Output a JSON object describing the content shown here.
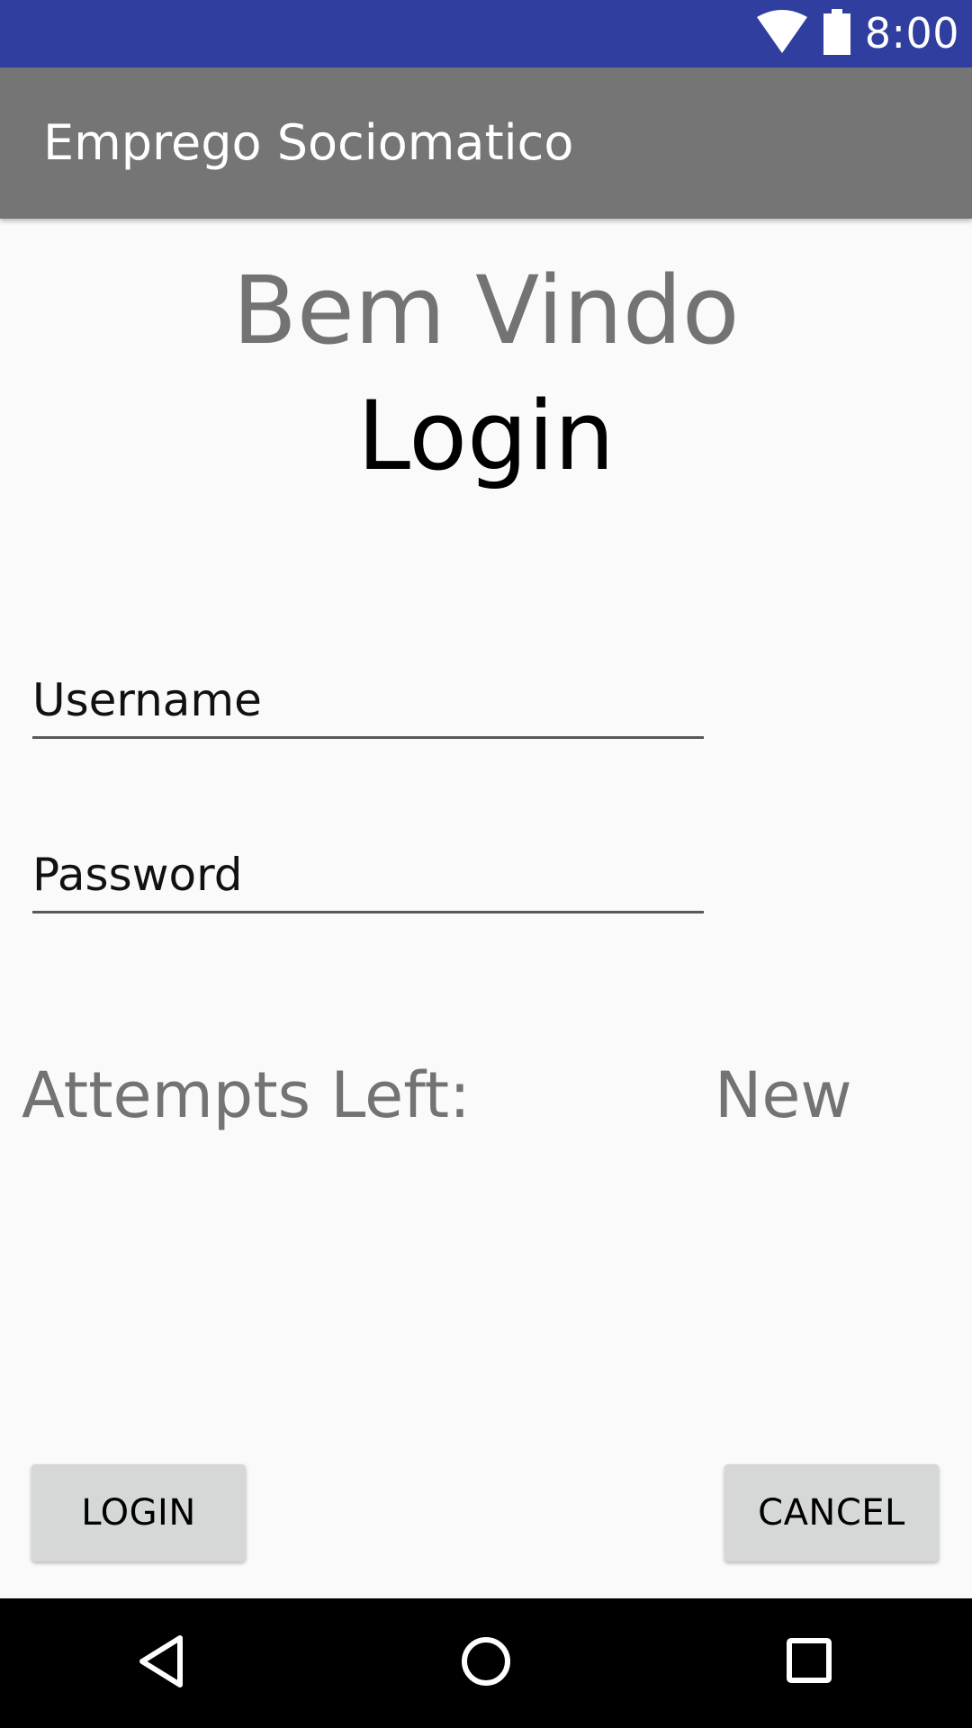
{
  "status_bar": {
    "time": "8:00",
    "icons": [
      "wifi-icon",
      "battery-icon"
    ],
    "color": "#303f9f"
  },
  "app_bar": {
    "title": "Emprego Sociomatico",
    "color": "#757575"
  },
  "main": {
    "welcome": "Bem Vindo",
    "heading": "Login",
    "username_placeholder": "Username",
    "password_placeholder": "Password",
    "attempts_label": "Attempts Left:",
    "attempts_value": "New"
  },
  "buttons": {
    "login_label": "LOGIN",
    "cancel_label": "CANCEL"
  },
  "nav_bar": {
    "icons": [
      "back-icon",
      "home-icon",
      "recents-icon"
    ]
  }
}
